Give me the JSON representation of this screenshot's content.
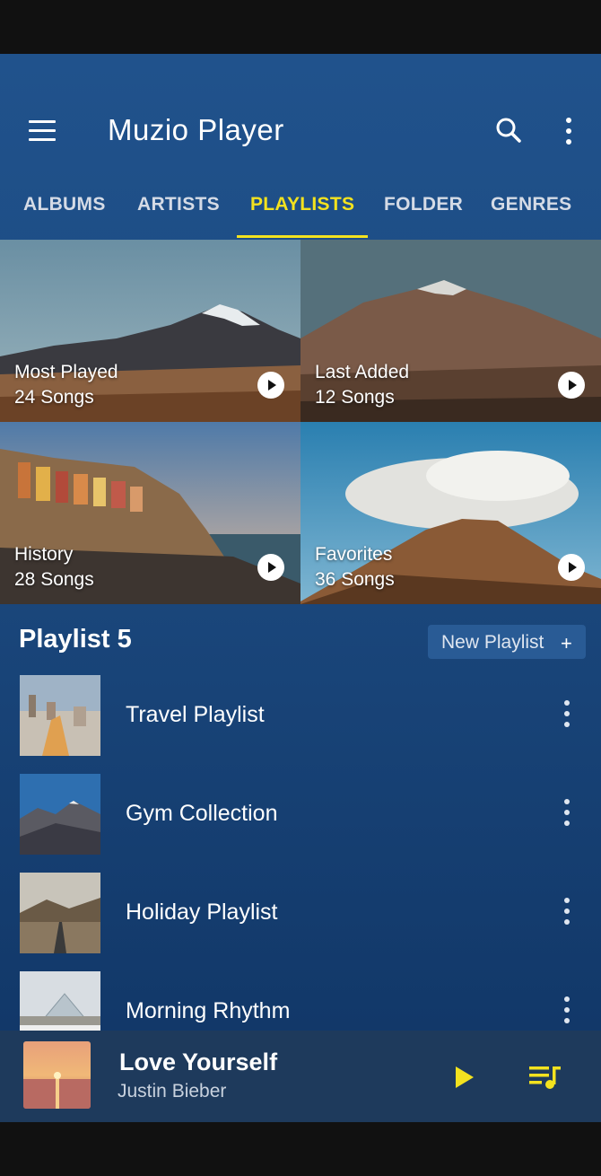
{
  "app": {
    "title": "Muzio Player"
  },
  "tabs": [
    {
      "label": "ALBUMS",
      "active": false
    },
    {
      "label": "ARTISTS",
      "active": false
    },
    {
      "label": "PLAYLISTS",
      "active": true
    },
    {
      "label": "FOLDER",
      "active": false
    },
    {
      "label": "GENRES",
      "active": false
    }
  ],
  "featured": [
    {
      "title": "Most Played",
      "count": "24 Songs"
    },
    {
      "title": "Last Added",
      "count": "12 Songs"
    },
    {
      "title": "History",
      "count": "28 Songs"
    },
    {
      "title": "Favorites",
      "count": "36 Songs"
    }
  ],
  "section": {
    "title": "Playlist 5",
    "new_button": "New Playlist",
    "new_icon": "+"
  },
  "playlists": [
    {
      "name": "Travel Playlist"
    },
    {
      "name": "Gym Collection"
    },
    {
      "name": "Holiday Playlist"
    },
    {
      "name": "Morning Rhythm"
    }
  ],
  "now_playing": {
    "title": "Love Yourself",
    "artist": "Justin Bieber"
  },
  "colors": {
    "accent": "#f3e21f",
    "background": "#1c4a80",
    "mini_player": "#1e3a5c"
  }
}
